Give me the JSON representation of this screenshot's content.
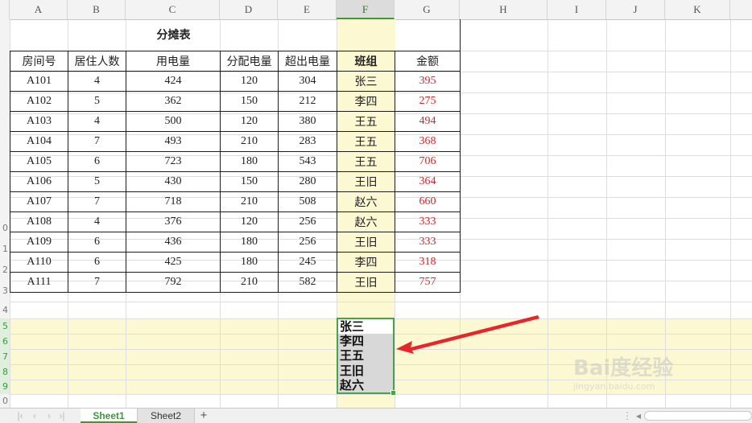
{
  "columns": [
    "A",
    "B",
    "C",
    "D",
    "E",
    "F",
    "G",
    "H",
    "I",
    "J",
    "K"
  ],
  "active_column": "F",
  "row_numbers": [
    "",
    "",
    "",
    "",
    "",
    "",
    "",
    "",
    "",
    "0",
    "1",
    "2",
    "3",
    "4",
    "5",
    "6",
    "7",
    "8",
    "9",
    "0"
  ],
  "table": {
    "title": "分摊表",
    "headers": [
      "房间号",
      "居住人数",
      "用电量",
      "分配电量",
      "超出电量",
      "班组",
      "金额"
    ],
    "rows": [
      [
        "A101",
        "4",
        "424",
        "120",
        "304",
        "张三",
        "395"
      ],
      [
        "A102",
        "5",
        "362",
        "150",
        "212",
        "李四",
        "275"
      ],
      [
        "A103",
        "4",
        "500",
        "120",
        "380",
        "王五",
        "494"
      ],
      [
        "A104",
        "7",
        "493",
        "210",
        "283",
        "王五",
        "368"
      ],
      [
        "A105",
        "6",
        "723",
        "180",
        "543",
        "王五",
        "706"
      ],
      [
        "A106",
        "5",
        "430",
        "150",
        "280",
        "王旧",
        "364"
      ],
      [
        "A107",
        "7",
        "718",
        "210",
        "508",
        "赵六",
        "660"
      ],
      [
        "A108",
        "4",
        "376",
        "120",
        "256",
        "赵六",
        "333"
      ],
      [
        "A109",
        "6",
        "436",
        "180",
        "256",
        "王旧",
        "333"
      ],
      [
        "A110",
        "6",
        "425",
        "180",
        "245",
        "李四",
        "318"
      ],
      [
        "A111",
        "7",
        "792",
        "210",
        "582",
        "王旧",
        "757"
      ]
    ]
  },
  "dropdown": {
    "options": [
      "张三",
      "李四",
      "王五",
      "王旧",
      "赵六"
    ]
  },
  "tabs": {
    "active": "Sheet1",
    "inactive": "Sheet2",
    "add": "+"
  },
  "watermark": {
    "logo": "Bai度经验",
    "sub": "jingyan.baidu.com"
  },
  "colors": {
    "accent_green": "#3a9a3a",
    "highlight_yellow": "#fbf8d2",
    "amount_red": "#d4252b",
    "arrow_red": "#e8252b"
  }
}
